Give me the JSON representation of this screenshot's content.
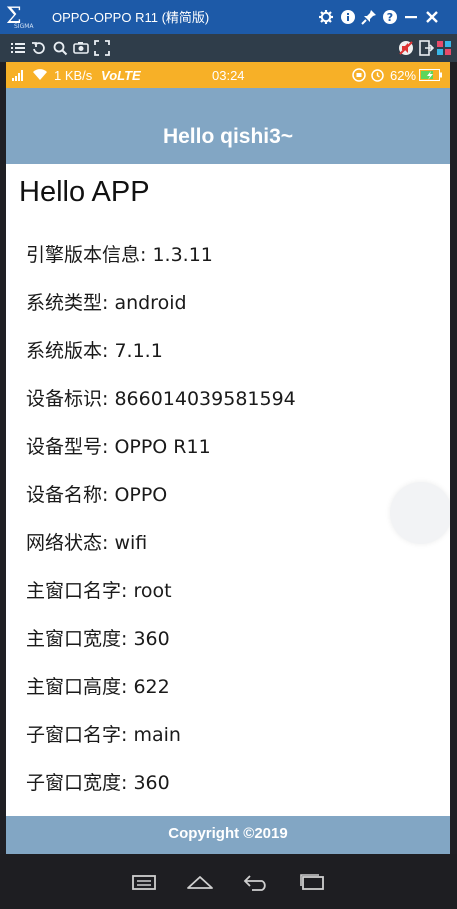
{
  "window": {
    "title": "OPPO-OPPO R11 (精简版)",
    "logo_text": "SIGMA",
    "titlebar_buttons": [
      "settings-icon",
      "info-icon",
      "pin-icon",
      "help-icon",
      "minimize-icon",
      "close-icon"
    ],
    "toolbar_left": [
      "menu-icon",
      "rotate-icon",
      "zoom-icon",
      "screenshot-icon",
      "fullscreen-icon"
    ],
    "toolbar_right": [
      "mute-icon",
      "export-icon",
      "apps-icon"
    ]
  },
  "statusbar": {
    "network_speed": "1 KB/s",
    "volte": "VoLTE",
    "time": "03:24",
    "battery": "62%"
  },
  "header": {
    "title": "Hello qishi3~"
  },
  "main": {
    "heading": "Hello APP",
    "rows": [
      "引擎版本信息: 1.3.11",
      "系统类型: android",
      "系统版本: 7.1.1",
      "设备标识: 866014039581594",
      "设备型号: OPPO R11",
      "设备名称: OPPO",
      "网络状态: wifi",
      "主窗口名字: root",
      "主窗口宽度: 360",
      "主窗口高度: 622",
      "子窗口名字: main",
      "子窗口宽度: 360"
    ]
  },
  "footer": {
    "copyright": "Copyright ©2019"
  },
  "navbar": [
    "menu-nav-icon",
    "home-nav-icon",
    "back-nav-icon",
    "recent-apps-icon"
  ],
  "colors": {
    "titlebar": "#1d5aa8",
    "statusbar": "#f7b027",
    "header": "#82a6c4",
    "footer": "#82a6c4"
  }
}
